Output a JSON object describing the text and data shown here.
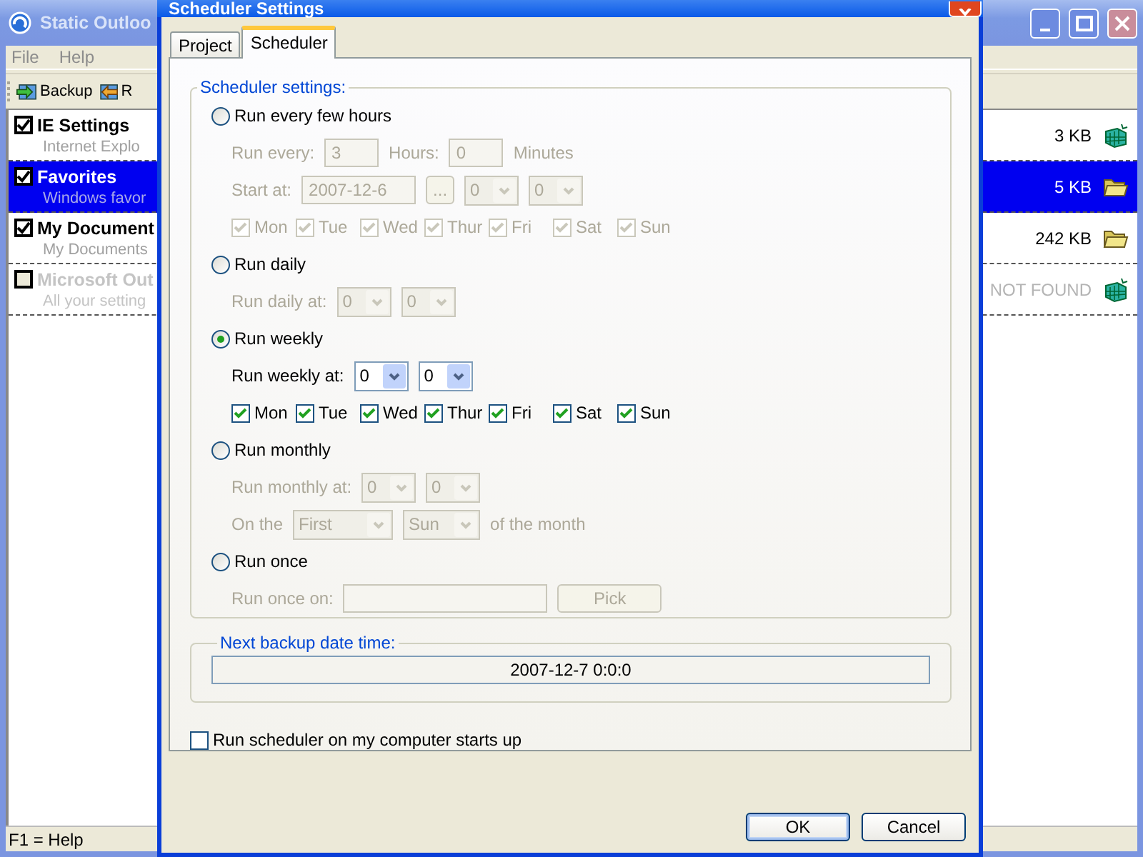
{
  "app": {
    "title": "Static Outloo",
    "menu": [
      "File",
      "Help"
    ],
    "toolbar": [
      {
        "label": "Backup",
        "kind": "backup"
      },
      {
        "label": "R",
        "kind": "restore"
      }
    ],
    "items": [
      {
        "name": "IE Settings",
        "description": "Internet Explo",
        "size": "3 KB",
        "kind": "settings",
        "checked": true,
        "selected": false,
        "disabled": false
      },
      {
        "name": "Favorites",
        "description": "Windows favor",
        "size": "5 KB",
        "kind": "folder",
        "checked": true,
        "selected": true,
        "disabled": false
      },
      {
        "name": "My Document",
        "description": "My Documents",
        "size": "242 KB",
        "kind": "folder",
        "checked": true,
        "selected": false,
        "disabled": false
      },
      {
        "name": "Microsoft Out",
        "description": "All your setting",
        "size": "NOT FOUND",
        "kind": "settings",
        "checked": false,
        "selected": false,
        "disabled": true
      }
    ],
    "status_bar": "F1 = Help"
  },
  "dialog": {
    "title": "Scheduler Settings",
    "tabs": [
      {
        "label": "Project",
        "selected": false
      },
      {
        "label": "Scheduler",
        "selected": true
      }
    ],
    "schedule": {
      "title": "Scheduler settings:",
      "modes": [
        {
          "label": "Run every few hours",
          "selected": false,
          "rows": [
            {
              "items": [
                {
                  "kind": "label",
                  "text": "Run every:"
                },
                {
                  "kind": "field",
                  "value": "3"
                },
                {
                  "kind": "label",
                  "text": "Hours:"
                },
                {
                  "kind": "field",
                  "value": "0"
                },
                {
                  "kind": "label",
                  "text": "Minutes"
                }
              ]
            },
            {
              "items": [
                {
                  "kind": "label",
                  "text": "Start at:"
                },
                {
                  "kind": "field",
                  "value": "2007-12-6"
                },
                {
                  "kind": "button",
                  "label": "..."
                },
                {
                  "kind": "combo",
                  "value": "0"
                },
                {
                  "kind": "combo",
                  "value": "0"
                }
              ]
            }
          ],
          "days": [
            {
              "label": "Mon",
              "checked": true
            },
            {
              "label": "Tue",
              "checked": true
            },
            {
              "label": "Wed",
              "checked": true
            },
            {
              "label": "Thur",
              "checked": true
            },
            {
              "label": "Fri",
              "checked": true
            },
            {
              "label": "Sat",
              "checked": true
            },
            {
              "label": "Sun",
              "checked": true
            }
          ]
        },
        {
          "label": "Run daily",
          "selected": false,
          "rows": [
            {
              "items": [
                {
                  "kind": "label",
                  "text": "Run daily at:"
                },
                {
                  "kind": "combo",
                  "value": "0"
                },
                {
                  "kind": "combo",
                  "value": "0"
                }
              ]
            }
          ]
        },
        {
          "label": "Run weekly",
          "selected": true,
          "rows": [
            {
              "items": [
                {
                  "kind": "label",
                  "text": "Run weekly at:"
                },
                {
                  "kind": "combo",
                  "value": "0"
                },
                {
                  "kind": "combo",
                  "value": "0"
                }
              ]
            }
          ],
          "days": [
            {
              "label": "Mon",
              "checked": true
            },
            {
              "label": "Tue",
              "checked": true
            },
            {
              "label": "Wed",
              "checked": true
            },
            {
              "label": "Thur",
              "checked": true
            },
            {
              "label": "Fri",
              "checked": true
            },
            {
              "label": "Sat",
              "checked": true
            },
            {
              "label": "Sun",
              "checked": true
            }
          ]
        },
        {
          "label": "Run monthly",
          "selected": false,
          "rows": [
            {
              "items": [
                {
                  "kind": "label",
                  "text": "Run monthly at:"
                },
                {
                  "kind": "combo",
                  "value": "0"
                },
                {
                  "kind": "combo",
                  "value": "0"
                }
              ]
            },
            {
              "items": [
                {
                  "kind": "label",
                  "text": "On the"
                },
                {
                  "kind": "combo",
                  "value": "First"
                },
                {
                  "kind": "combo",
                  "value": "Sun"
                },
                {
                  "kind": "label",
                  "text": "of the month"
                }
              ]
            }
          ]
        },
        {
          "label": "Run once",
          "selected": false,
          "rows": [
            {
              "items": [
                {
                  "kind": "label",
                  "text": "Run once on:"
                },
                {
                  "kind": "field"
                },
                {
                  "kind": "button",
                  "label": "Pick"
                }
              ]
            }
          ]
        }
      ]
    },
    "next_backup": {
      "title": "Next backup date time:",
      "value": "2007-12-7 0:0:0"
    },
    "startup": {
      "label": "Run scheduler on my computer starts up",
      "checked": false
    },
    "buttons": [
      {
        "label": "OK",
        "default": true
      },
      {
        "label": "Cancel",
        "default": false
      }
    ]
  }
}
